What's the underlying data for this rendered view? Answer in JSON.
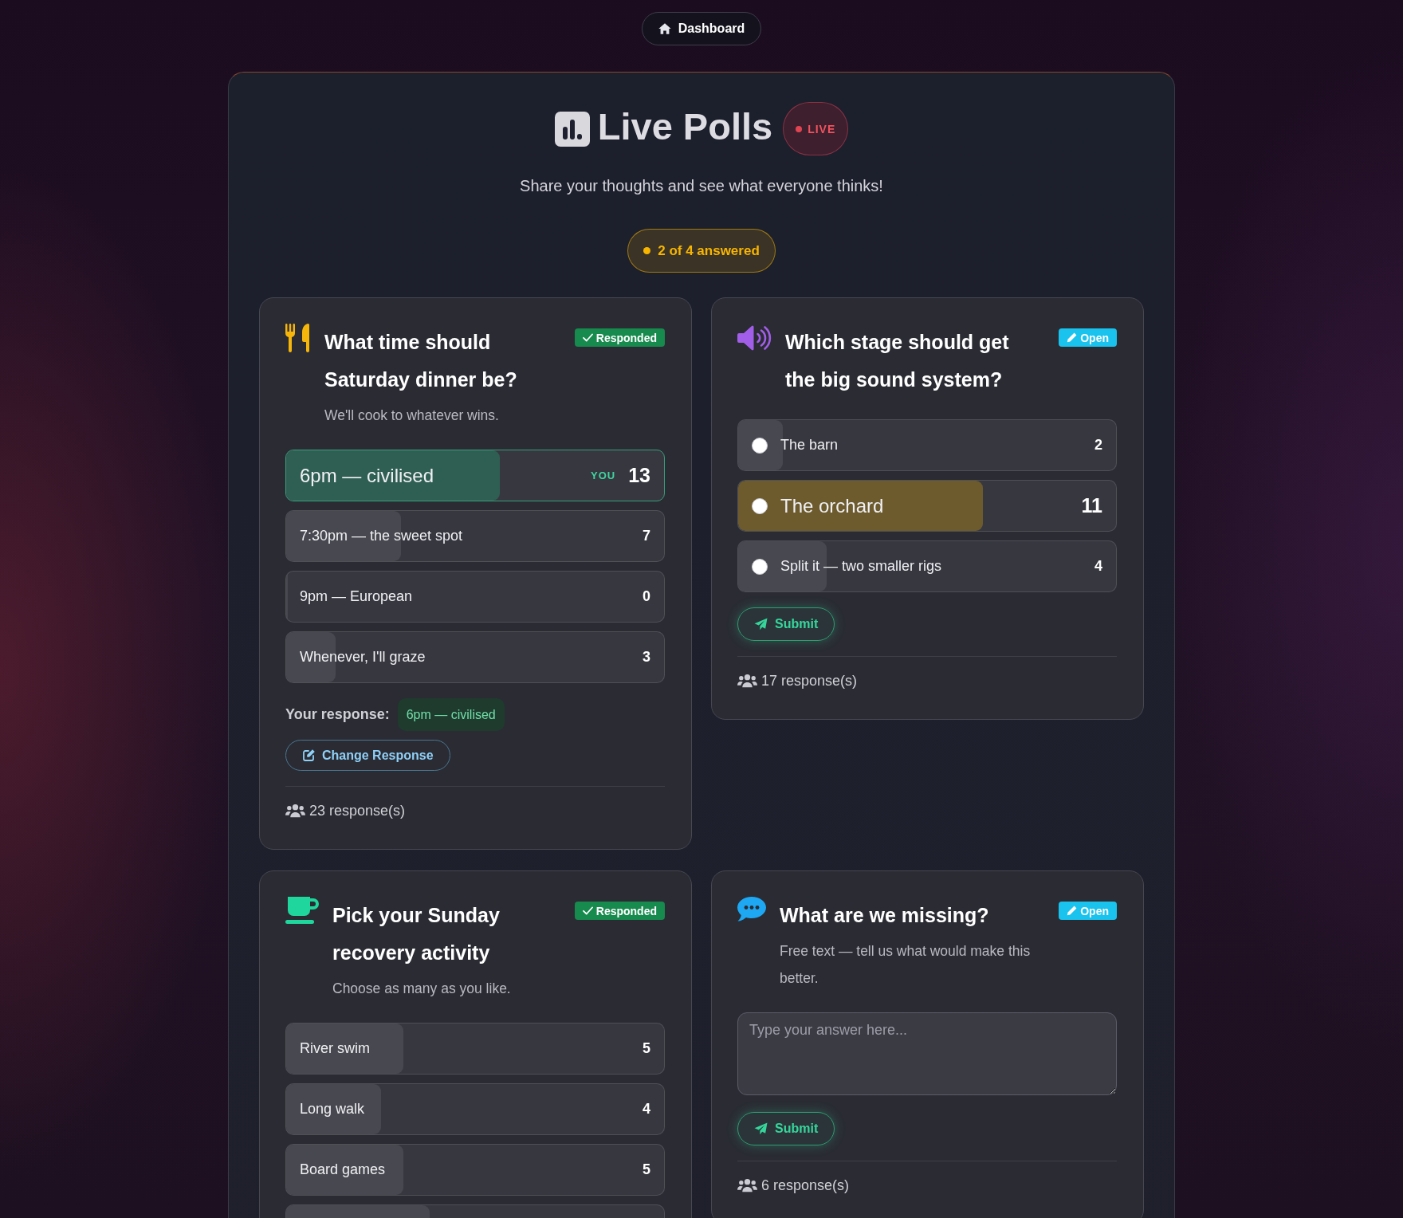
{
  "nav": {
    "label": "Dashboard"
  },
  "header": {
    "title": "Live Polls",
    "live_badge": "LIVE",
    "subtitle": "Share your thoughts and see what everyone thinks!",
    "progress": "2 of 4 answered"
  },
  "polls": [
    {
      "kind": "choice",
      "question": "What time should Saturday dinner be?",
      "description": "We'll cook to whatever wins.",
      "responded": true,
      "status": "Responded",
      "options": [
        {
          "label": "6pm — civilised",
          "count": "13",
          "level": 0.565,
          "selected": true,
          "leading": true,
          "you_tag": "YOU"
        },
        {
          "label": "7:30pm — the sweet spot",
          "count": "7",
          "level": 0.304,
          "selected": false,
          "leading": false
        },
        {
          "label": "9pm — European",
          "count": "0",
          "level": 0,
          "selected": false,
          "leading": false
        },
        {
          "label": "Whenever, I'll graze",
          "count": "3",
          "level": 0.13,
          "selected": false,
          "leading": false
        }
      ],
      "your_response": {
        "label": "Your response:",
        "value": "6pm — civilised"
      },
      "change_button": "Change Response",
      "responses": "23 response(s)"
    },
    {
      "kind": "choice",
      "question": "Which stage should get the big sound system?",
      "responded": false,
      "status": "Open",
      "options": [
        {
          "label": "The barn",
          "count": "2",
          "level": 0.118,
          "selected": false,
          "leading": false
        },
        {
          "label": "The orchard",
          "count": "11",
          "level": 0.647,
          "selected": false,
          "leading": true
        },
        {
          "label": "Split it — two smaller rigs",
          "count": "4",
          "level": 0.235,
          "selected": false,
          "leading": false
        }
      ],
      "submit_button": "Submit",
      "responses": "17 response(s)"
    },
    {
      "kind": "choice",
      "question": "Pick your Sunday recovery activity",
      "description": "Choose as many as you like.",
      "responded": true,
      "status": "Responded",
      "options": [
        {
          "label": "River swim",
          "count": "5",
          "level": 0.31,
          "selected": false,
          "leading": false
        },
        {
          "label": "Long walk",
          "count": "4",
          "level": 0.25,
          "selected": false,
          "leading": false
        },
        {
          "label": "Board games",
          "count": "5",
          "level": 0.31,
          "selected": false,
          "leading": false
        },
        {
          "level": 0.38,
          "selected": false,
          "leading": false
        }
      ]
    },
    {
      "kind": "text",
      "question": "What are we missing?",
      "description": "Free text — tell us what would make this better.",
      "responded": false,
      "status": "Open",
      "placeholder": "Type your answer here...",
      "submit_button": "Submit",
      "responses": "6 response(s)"
    }
  ]
}
